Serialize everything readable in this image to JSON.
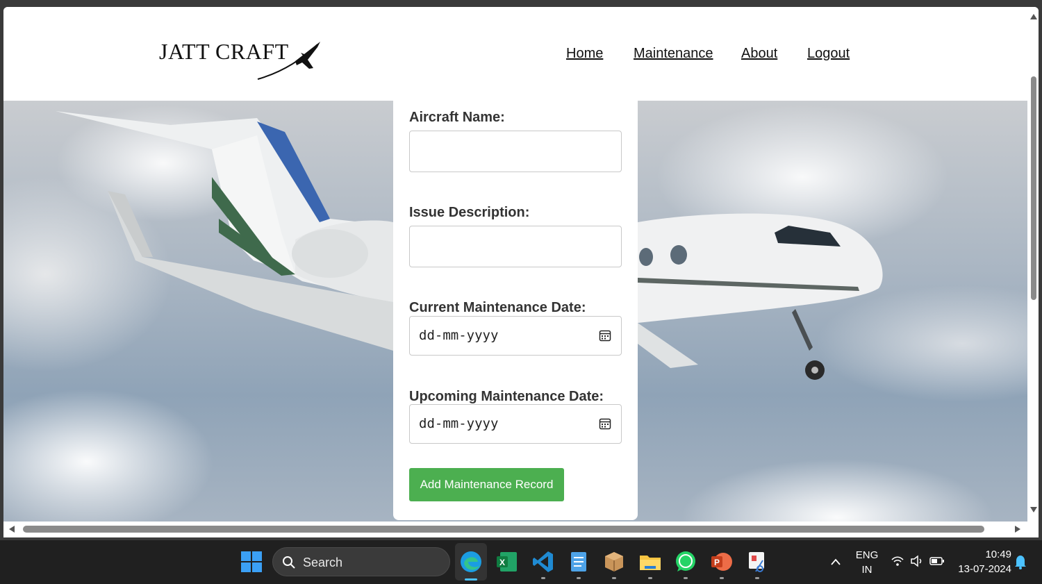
{
  "brand": {
    "name": "JATT CRAFT"
  },
  "nav": {
    "home": "Home",
    "maintenance": "Maintenance",
    "about": "About",
    "logout": "Logout"
  },
  "form": {
    "aircraft_name_label": "Aircraft Name:",
    "aircraft_name_value": "",
    "issue_label": "Issue Description:",
    "issue_value": "",
    "current_date_label": "Current Maintenance Date:",
    "current_date_placeholder": "dd-mm-yyyy",
    "upcoming_date_label": "Upcoming Maintenance Date:",
    "upcoming_date_placeholder": "dd-mm-yyyy",
    "submit_label": "Add Maintenance Record"
  },
  "taskbar": {
    "search_placeholder": "Search",
    "apps": [
      "start-icon",
      "edge-icon",
      "excel-icon",
      "vscode-icon",
      "notepad-icon",
      "package-icon",
      "file-explorer-icon",
      "whatsapp-icon",
      "powerpoint-icon",
      "snipping-tool-icon"
    ],
    "lang_top": "ENG",
    "lang_bottom": "IN",
    "time": "10:49",
    "date": "13-07-2024"
  },
  "colors": {
    "accent_button": "#4caf50",
    "taskbar": "#202020"
  }
}
